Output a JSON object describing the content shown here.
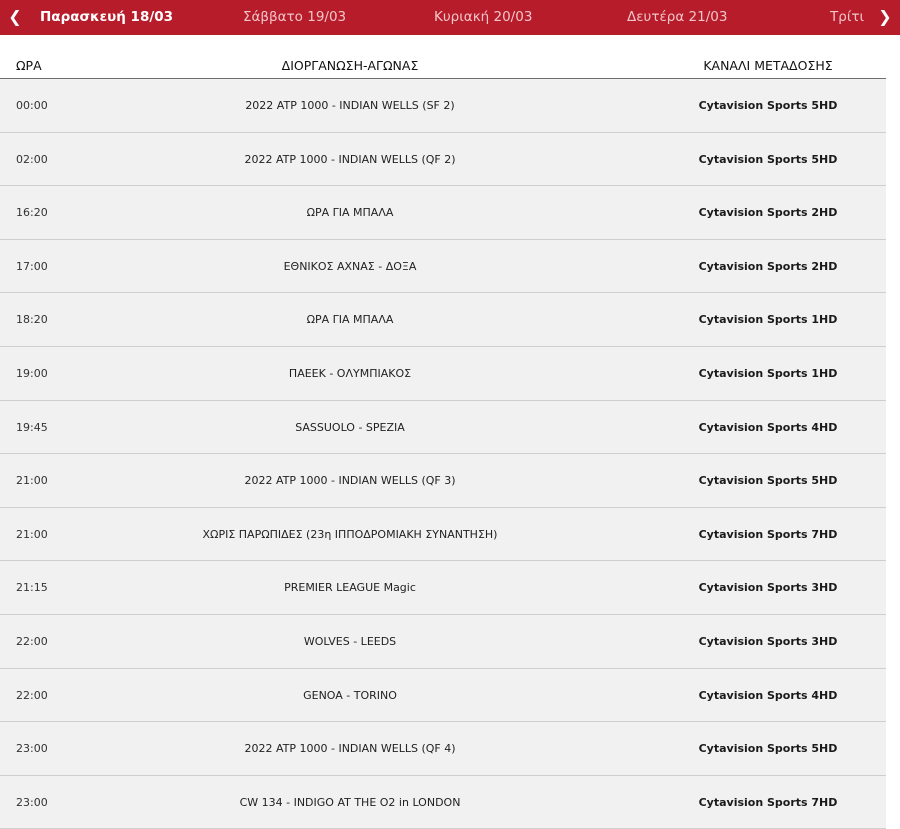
{
  "nav": {
    "prev_icon": "chevron-left-icon",
    "next_icon": "chevron-right-icon",
    "prev_glyph": "❮",
    "next_glyph": "❯",
    "days": [
      {
        "label": "Παρασκευή 18/03",
        "active": true
      },
      {
        "label": "Σάββατο 19/03",
        "active": false
      },
      {
        "label": "Κυριακή 20/03",
        "active": false
      },
      {
        "label": "Δευτέρα 21/03",
        "active": false
      },
      {
        "label": "Τρίτι",
        "active": false
      }
    ],
    "bar_color": "#b71c2b"
  },
  "table": {
    "headers": {
      "time": "ΩΡΑ",
      "event": "ΔΙΟΡΓΑΝΩΣΗ-ΑΓΩΝΑΣ",
      "channel": "ΚΑΝΑΛΙ ΜΕΤΑΔΟΣΗΣ"
    },
    "rows": [
      {
        "time": "00:00",
        "event": "2022 ATP 1000 - INDIAN WELLS (SF 2)",
        "channel": "Cytavision Sports 5HD"
      },
      {
        "time": "02:00",
        "event": "2022 ATP 1000 - INDIAN WELLS (QF 2)",
        "channel": "Cytavision Sports 5HD"
      },
      {
        "time": "16:20",
        "event": "ΩΡΑ ΓΙΑ ΜΠΑΛΑ",
        "channel": "Cytavision Sports 2HD"
      },
      {
        "time": "17:00",
        "event": "ΕΘΝΙΚΟΣ ΑΧΝΑΣ - ΔΟΞΑ",
        "channel": "Cytavision Sports 2HD"
      },
      {
        "time": "18:20",
        "event": "ΩΡΑ ΓΙΑ ΜΠΑΛΑ",
        "channel": "Cytavision Sports 1HD"
      },
      {
        "time": "19:00",
        "event": "ΠΑΕΕΚ - ΟΛΥΜΠΙΑΚΟΣ",
        "channel": "Cytavision Sports 1HD"
      },
      {
        "time": "19:45",
        "event": "SASSUOLO - SPEZIA",
        "channel": "Cytavision Sports 4HD"
      },
      {
        "time": "21:00",
        "event": "2022 ATP 1000 - INDIAN WELLS (QF 3)",
        "channel": "Cytavision Sports 5HD"
      },
      {
        "time": "21:00",
        "event": "ΧΩΡΙΣ ΠΑΡΩΠΙΔΕΣ (23η ΙΠΠΟΔΡΟΜΙΑΚΗ ΣΥΝΑΝΤΗΣΗ)",
        "channel": "Cytavision Sports 7HD"
      },
      {
        "time": "21:15",
        "event": "PREMIER LEAGUE Magic",
        "channel": "Cytavision Sports 3HD"
      },
      {
        "time": "22:00",
        "event": "WOLVES - LEEDS",
        "channel": "Cytavision Sports 3HD"
      },
      {
        "time": "22:00",
        "event": "GENOA - TORINO",
        "channel": "Cytavision Sports 4HD"
      },
      {
        "time": "23:00",
        "event": "2022 ATP 1000 - INDIAN WELLS (QF 4)",
        "channel": "Cytavision Sports 5HD"
      },
      {
        "time": "23:00",
        "event": "CW 134 - INDIGO AT THE O2 in LONDON",
        "channel": "Cytavision Sports 7HD"
      }
    ]
  }
}
